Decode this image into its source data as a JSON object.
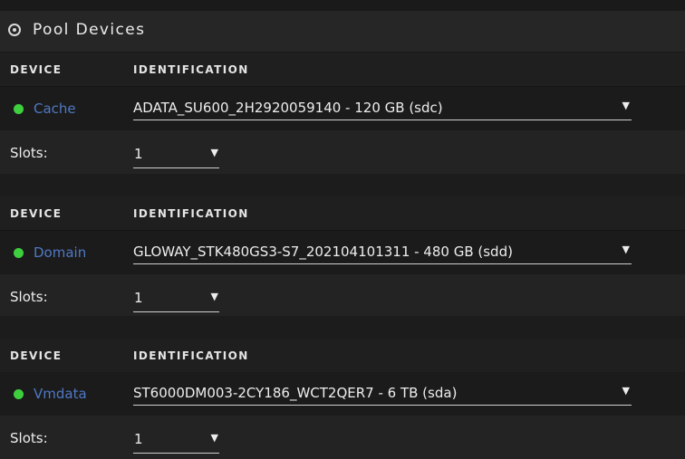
{
  "section": {
    "title": "Pool Devices",
    "icon": "disc-icon"
  },
  "columns": {
    "device": "DEVICE",
    "identification": "IDENTIFICATION"
  },
  "slots_label": "Slots:",
  "colors": {
    "status_ok": "#3ecf3e",
    "link": "#4f78c4"
  },
  "pools": [
    {
      "device": "Cache",
      "status": "online",
      "identification": "ADATA_SU600_2H2920059140 - 120 GB (sdc)",
      "slots": "1"
    },
    {
      "device": "Domain",
      "status": "online",
      "identification": "GLOWAY_STK480GS3-S7_202104101311 - 480 GB (sdd)",
      "slots": "1"
    },
    {
      "device": "Vmdata",
      "status": "online",
      "identification": "ST6000DM003-2CY186_WCT2QER7 - 6 TB (sda)",
      "slots": "1"
    }
  ]
}
